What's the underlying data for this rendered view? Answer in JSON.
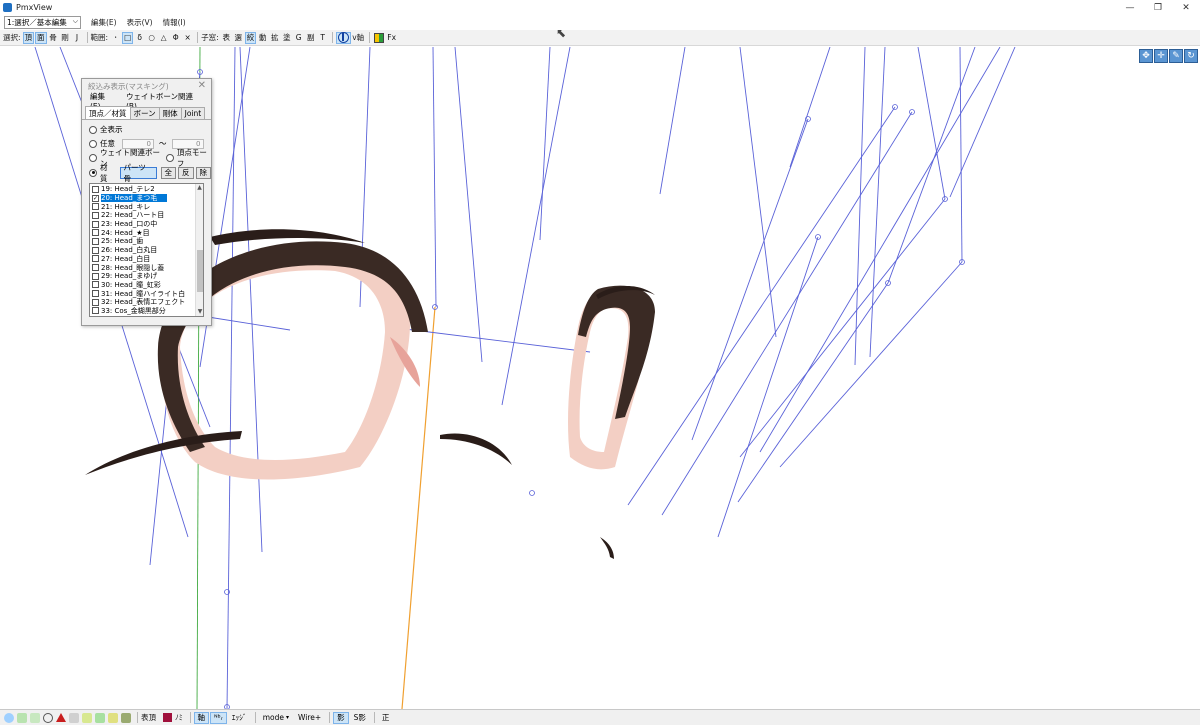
{
  "window": {
    "title": "PmxView",
    "controls": {
      "minimize": "—",
      "restore": "❐",
      "close": "✕"
    }
  },
  "menubar": {
    "mode_select": "1:選択／基本編集",
    "items": [
      "編集(E)",
      "表示(V)",
      "情報(I)"
    ]
  },
  "toolbar": {
    "select_label": "選択:",
    "select_buttons": [
      "頂",
      "面",
      "骨",
      "剛",
      "J"
    ],
    "range_label": "範囲:",
    "range_buttons": [
      "･",
      "□",
      "δ",
      "○",
      "△",
      "Φ",
      "×"
    ],
    "coord_label": "子窓:",
    "coord_buttons": [
      "表",
      "選",
      "絞",
      "動",
      "拡",
      "塗",
      "G",
      "副",
      "T"
    ],
    "vaxis_label": "v軸",
    "fx_label": "Fx"
  },
  "panel": {
    "title": "絞込み表示(マスキング)",
    "menu": [
      "編集(E)",
      "ウェイトボーン関連(B)"
    ],
    "tabs": [
      "頂点／材質",
      "ボーン",
      "剛体",
      "Joint"
    ],
    "options": {
      "show_all": "全表示",
      "arbitrary": "任意",
      "arbitrary_from": "0",
      "arbitrary_to": "0",
      "tilde": "〜",
      "weight_bone": "ウェイト関連ボーン",
      "vertex_morph": "頂点モーフ",
      "material": "材質"
    },
    "buttons": {
      "parts": "パーツ骨",
      "all": "全",
      "invert": "反",
      "remove": "除"
    },
    "materials": [
      {
        "label": "19: Head_テレ2",
        "checked": false,
        "selected": false
      },
      {
        "label": "20: Head_まつ毛",
        "checked": true,
        "selected": true
      },
      {
        "label": "21: Head_キレ",
        "checked": false,
        "selected": false
      },
      {
        "label": "22: Head_ハート目",
        "checked": false,
        "selected": false
      },
      {
        "label": "23: Head_口の中",
        "checked": false,
        "selected": false
      },
      {
        "label": "24: Head_★目",
        "checked": false,
        "selected": false
      },
      {
        "label": "25: Head_歯",
        "checked": false,
        "selected": false
      },
      {
        "label": "26: Head_白丸目",
        "checked": false,
        "selected": false
      },
      {
        "label": "27: Head_白目",
        "checked": false,
        "selected": false
      },
      {
        "label": "28: Head_眼隠し蓋",
        "checked": false,
        "selected": false
      },
      {
        "label": "29: Head_まゆげ",
        "checked": false,
        "selected": false
      },
      {
        "label": "30: Head_瞳_虹彩",
        "checked": false,
        "selected": false
      },
      {
        "label": "31: Head_瞳ハイライト白",
        "checked": false,
        "selected": false
      },
      {
        "label": "32: Head_表情エフェクト",
        "checked": false,
        "selected": false
      },
      {
        "label": "33: Cos_金糊黒部分",
        "checked": false,
        "selected": false
      }
    ]
  },
  "statusbar": {
    "surface_label": "表頂",
    "no_label": "ﾉﾐ",
    "axis_label": "軸",
    "edge_label": "ｴｯｼﾞ",
    "mode_label": "mode",
    "wire_label": "Wire+",
    "shadow_label": "影",
    "sshadow_label": "S影",
    "front_label": "正"
  },
  "colors": {
    "bone_line": "#5a62d8",
    "accent": "#0078d7",
    "axis_orange": "#f0a030",
    "axis_green": "#2aa02a"
  }
}
